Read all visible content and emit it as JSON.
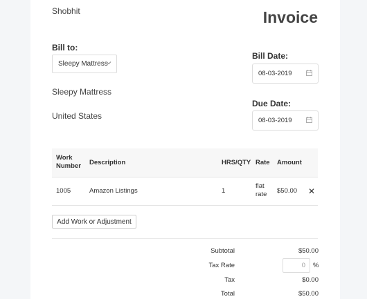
{
  "header": {
    "company": "Shobhit",
    "title": "Invoice"
  },
  "bill_to": {
    "label": "Bill to:",
    "selected_customer": "Sleepy Mattress",
    "address_line1": "Sleepy Mattress",
    "address_line2": "United States"
  },
  "dates": {
    "bill_label": "Bill Date:",
    "bill_value": "08-03-2019",
    "due_label": "Due Date:",
    "due_value": "08-03-2019"
  },
  "table": {
    "headers": {
      "work_number_line1": "Work",
      "work_number_line2": "Number",
      "description": "Description",
      "hrs_qty": "HRS/QTY",
      "rate": "Rate",
      "amount": "Amount"
    },
    "rows": [
      {
        "work_number": "1005",
        "description": "Amazon Listings",
        "qty": "1",
        "rate_line1": "flat",
        "rate_line2": "rate",
        "amount": "$50.00",
        "remove": "✕"
      }
    ]
  },
  "add_button_label": "Add Work or Adjustment",
  "summary": {
    "subtotal_label": "Subtotal",
    "subtotal_value": "$50.00",
    "tax_rate_label": "Tax Rate",
    "tax_rate_value": "0",
    "tax_rate_unit": "%",
    "tax_label": "Tax",
    "tax_value": "$0.00",
    "total_label": "Total",
    "total_value": "$50.00"
  },
  "icons": {
    "select_chevron": "chevron-down-icon",
    "date_picker": "calendar-icon",
    "remove_row": "close-icon"
  }
}
